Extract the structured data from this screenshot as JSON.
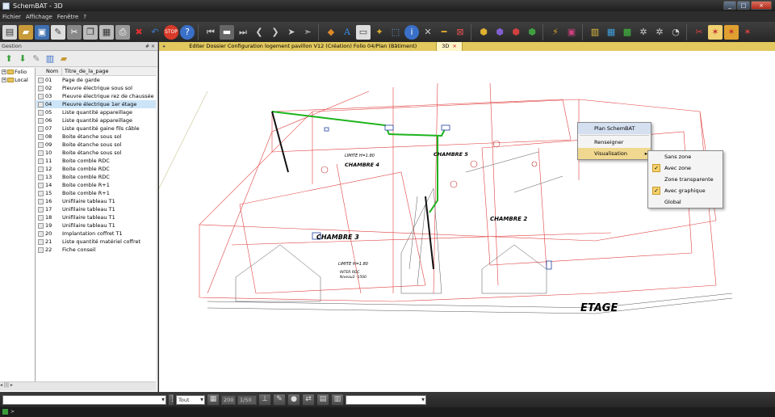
{
  "app": {
    "title": "SchemBAT - 3D"
  },
  "menu": [
    "Fichier",
    "Affichage",
    "Fenêtre",
    "?"
  ],
  "panel": {
    "title": "Gestion",
    "pin": "# ×",
    "tree": [
      "Folio",
      "Local"
    ],
    "columns": {
      "nom": "Nom",
      "titre": "Titre_de_la_page"
    },
    "rows": [
      {
        "num": "01",
        "title": "Page de garde",
        "selected": false
      },
      {
        "num": "02",
        "title": "Pieuvre électrique sous sol",
        "selected": false
      },
      {
        "num": "03",
        "title": "Pieuvre électrique rez de chaussée",
        "selected": false
      },
      {
        "num": "04",
        "title": "Pieuvre électrique 1er étage",
        "selected": true
      },
      {
        "num": "05",
        "title": "Liste quantité appareillage",
        "selected": false
      },
      {
        "num": "06",
        "title": "Liste quantité appareillage",
        "selected": false
      },
      {
        "num": "07",
        "title": "Liste quantité gaine fils câble",
        "selected": false
      },
      {
        "num": "08",
        "title": "Boite étanche sous sol",
        "selected": false
      },
      {
        "num": "09",
        "title": "Boite étanche sous sol",
        "selected": false
      },
      {
        "num": "10",
        "title": "Boite étanche sous sol",
        "selected": false
      },
      {
        "num": "11",
        "title": "Boite comble RDC",
        "selected": false
      },
      {
        "num": "12",
        "title": "Boite comble RDC",
        "selected": false
      },
      {
        "num": "13",
        "title": "Boite comble RDC",
        "selected": false
      },
      {
        "num": "14",
        "title": "Boite comble R+1",
        "selected": false
      },
      {
        "num": "15",
        "title": "Boite comble R+1",
        "selected": false
      },
      {
        "num": "16",
        "title": "Unifilaire tableau T1",
        "selected": false
      },
      {
        "num": "17",
        "title": "Unifilaire tableau T1",
        "selected": false
      },
      {
        "num": "18",
        "title": "Unifilaire tableau T1",
        "selected": false
      },
      {
        "num": "19",
        "title": "Unifilaire tableau T1",
        "selected": false
      },
      {
        "num": "20",
        "title": "Implantation coffret T1",
        "selected": false
      },
      {
        "num": "21",
        "title": "Liste quantité matériel coffret",
        "selected": false
      },
      {
        "num": "22",
        "title": "Fiche conseil",
        "selected": false
      }
    ],
    "scroll": "◂  |||  ▸"
  },
  "tabs": [
    {
      "label": "Editer Dossier  Configuration logement pavillon V12  (Création)  Folio  04/Plan (Bâtiment)",
      "active": false
    },
    {
      "label": "3D",
      "active": true,
      "close": "×"
    }
  ],
  "drawing": {
    "rooms": [
      "CHAMBRE 4",
      "CHAMBRE 5",
      "CHAMBRE 2",
      "CHAMBRE 3"
    ],
    "floor_label": "ETAGE",
    "notes": [
      "LIMITE H=1.80",
      "LIMITE H=1.80",
      "INTER RDC",
      "Niveau2 -1500"
    ]
  },
  "context_menu": {
    "main": [
      "Plan SchemBAT",
      "Renseigner",
      "Visualisation"
    ],
    "sub": [
      {
        "label": "Sans zone",
        "checked": false
      },
      {
        "label": "Avec zone",
        "checked": true
      },
      {
        "label": "Zone transparente",
        "checked": false
      },
      {
        "label": "Avec graphique",
        "checked": true
      },
      {
        "label": "Global",
        "checked": false
      }
    ],
    "check_mark": "✓",
    "arrow": "▸"
  },
  "bottombar": {
    "filter": "Tout",
    "zoom": "200",
    "scale": "1/50"
  },
  "status": {
    "text": ">"
  },
  "colors": {
    "selection": "#cce4f7",
    "tab_bar": "#e2c85e",
    "wire_green": "#1db31d",
    "wall_red": "#e04040"
  }
}
